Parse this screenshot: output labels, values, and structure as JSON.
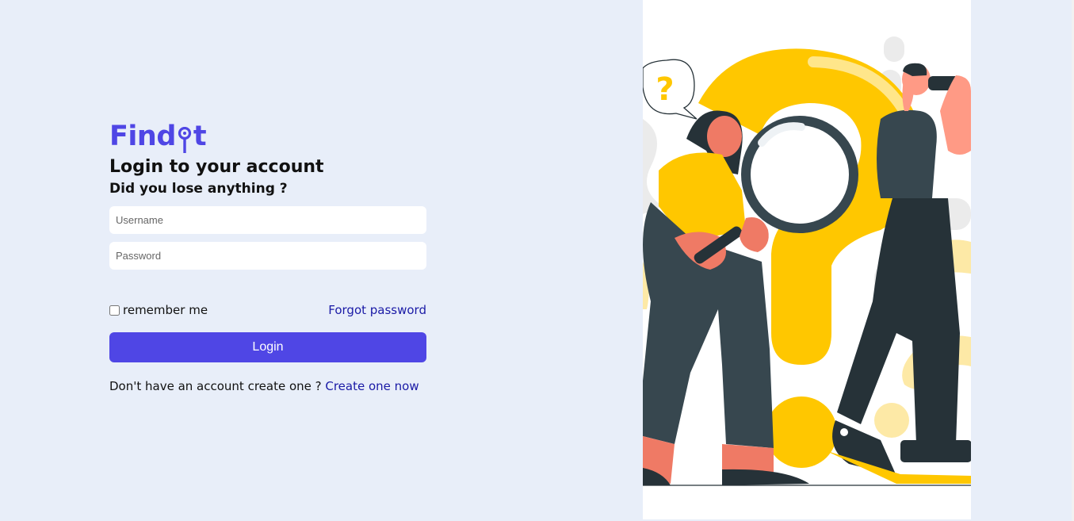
{
  "brand": {
    "logo_prefix": "Find",
    "logo_suffix": "t",
    "accent_color": "#4f46e5",
    "illustration_accent": "#ffc700"
  },
  "login": {
    "title": "Login to your account",
    "subtitle": "Did you lose anything ?",
    "username_placeholder": "Username",
    "password_placeholder": "Password",
    "remember_label": "remember me",
    "forgot_link": "Forgot password",
    "login_button": "Login",
    "signup_prompt": "Don't have an account create one ? ",
    "signup_link": "Create one now"
  },
  "illustration": {
    "question_mark_icon": "?"
  }
}
